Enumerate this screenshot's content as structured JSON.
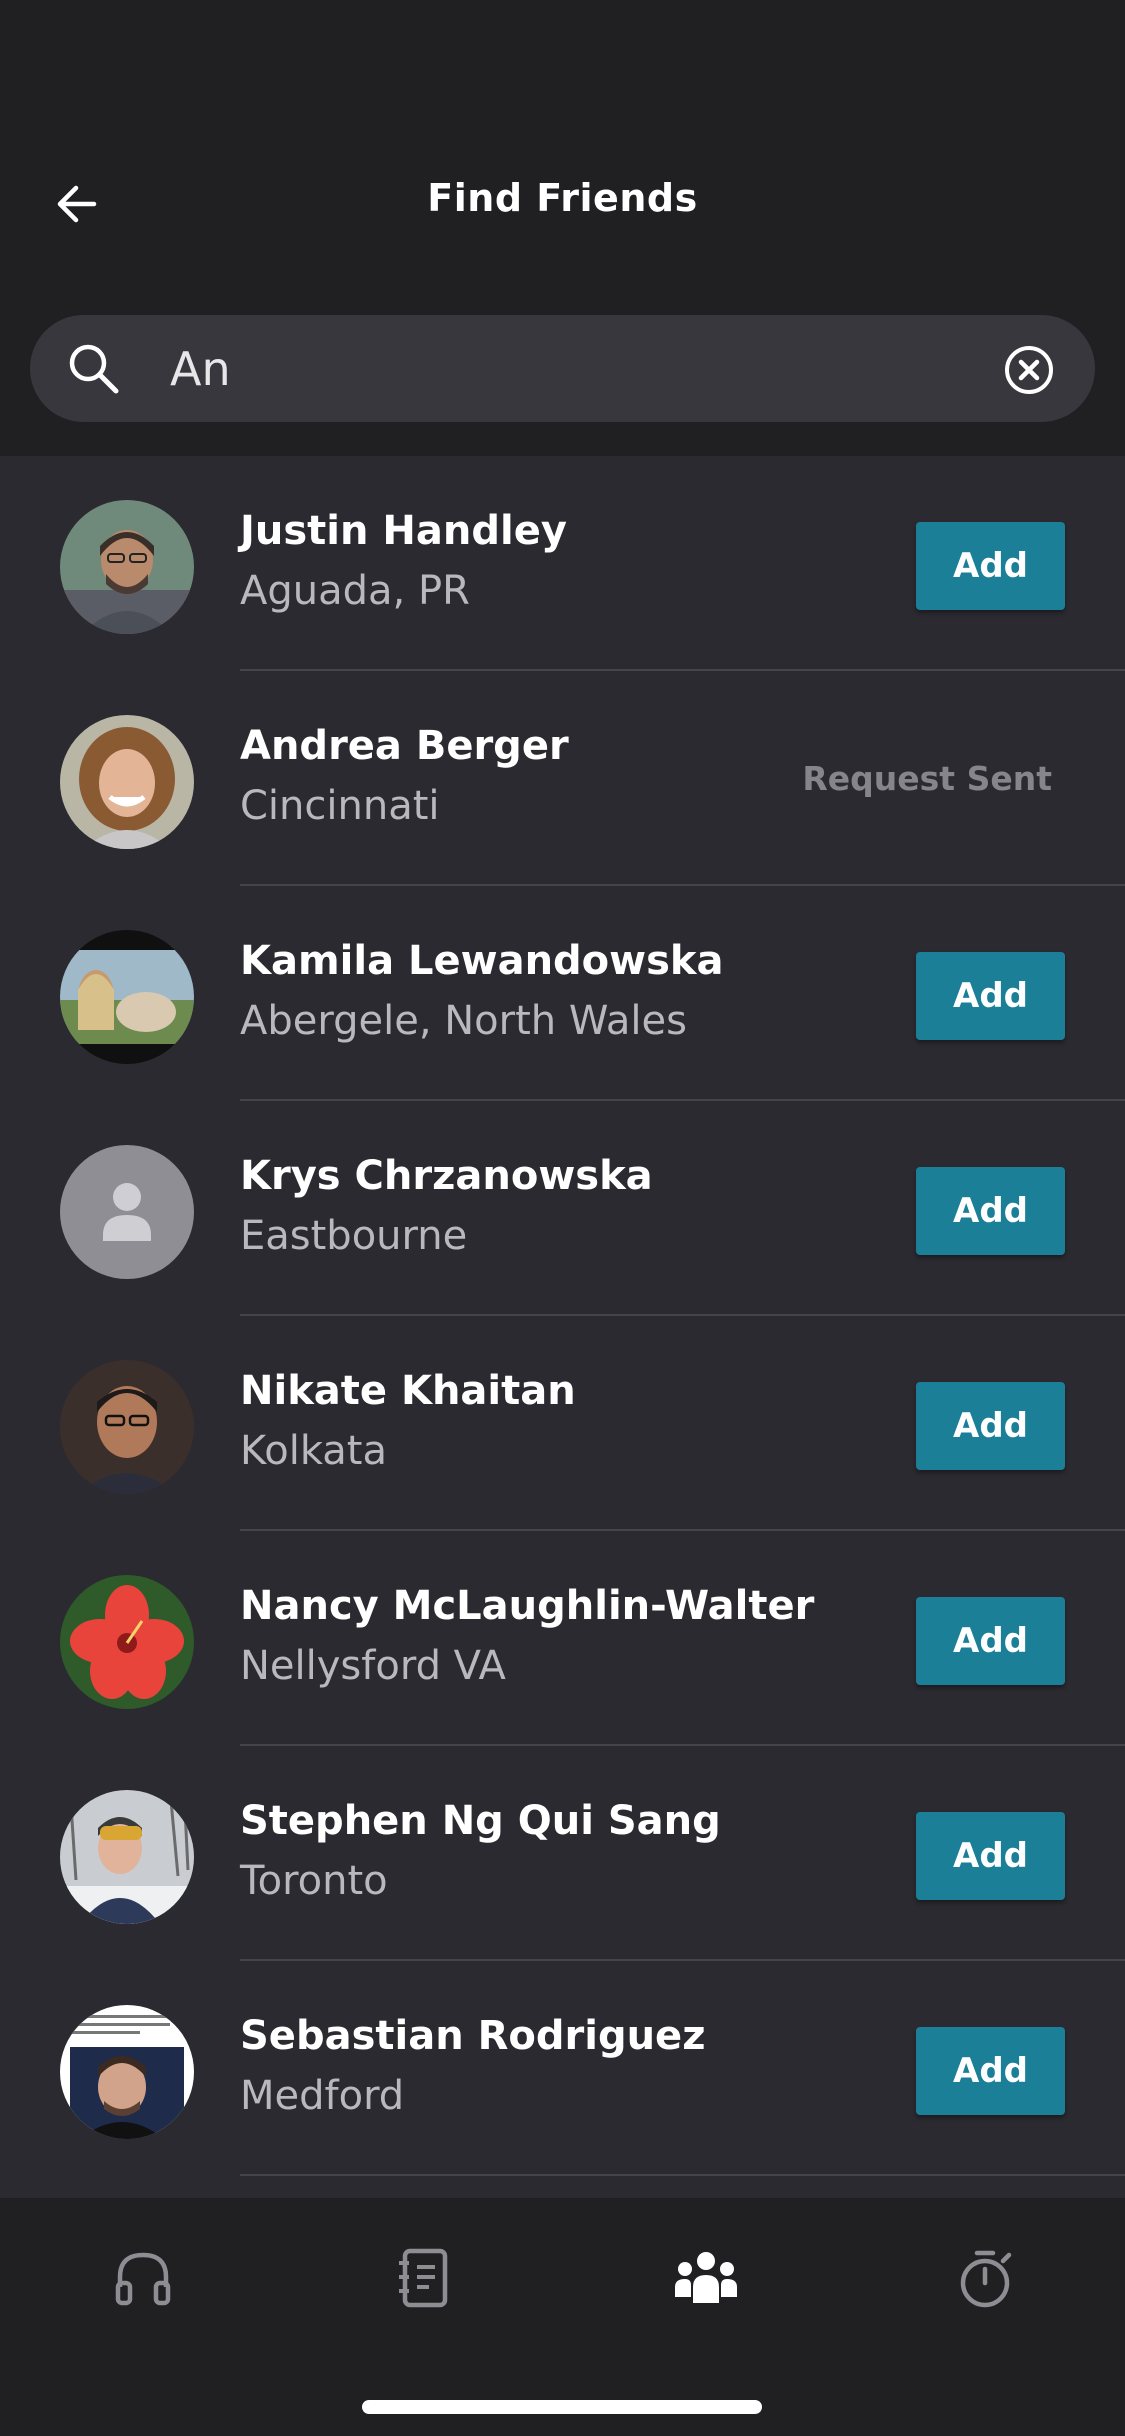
{
  "header": {
    "title": "Find Friends"
  },
  "search": {
    "value": "An",
    "placeholder": ""
  },
  "people": [
    {
      "name": "Justin Handley",
      "location": "Aguada, PR",
      "status": "add"
    },
    {
      "name": "Andrea Berger",
      "location": "Cincinnati",
      "status": "sent"
    },
    {
      "name": "Kamila Lewandowska",
      "location": "Abergele, North Wales",
      "status": "add"
    },
    {
      "name": "Krys Chrzanowska",
      "location": "Eastbourne",
      "status": "add"
    },
    {
      "name": "Nikate Khaitan",
      "location": "Kolkata",
      "status": "add"
    },
    {
      "name": "Nancy McLaughlin-Walter",
      "location": "Nellysford VA",
      "status": "add"
    },
    {
      "name": "Stephen Ng Qui Sang",
      "location": "Toronto",
      "status": "add"
    },
    {
      "name": "Sebastian Rodriguez",
      "location": "Medford",
      "status": "add"
    }
  ],
  "actions": {
    "add_label": "Add",
    "sent_label": "Request Sent"
  },
  "tabs": [
    {
      "icon": "headphones-icon",
      "active": false
    },
    {
      "icon": "journal-icon",
      "active": false
    },
    {
      "icon": "friends-icon",
      "active": true
    },
    {
      "icon": "stopwatch-icon",
      "active": false
    }
  ],
  "colors": {
    "accent": "#1a7f97",
    "background": "#2b2a30",
    "header": "#202023"
  }
}
